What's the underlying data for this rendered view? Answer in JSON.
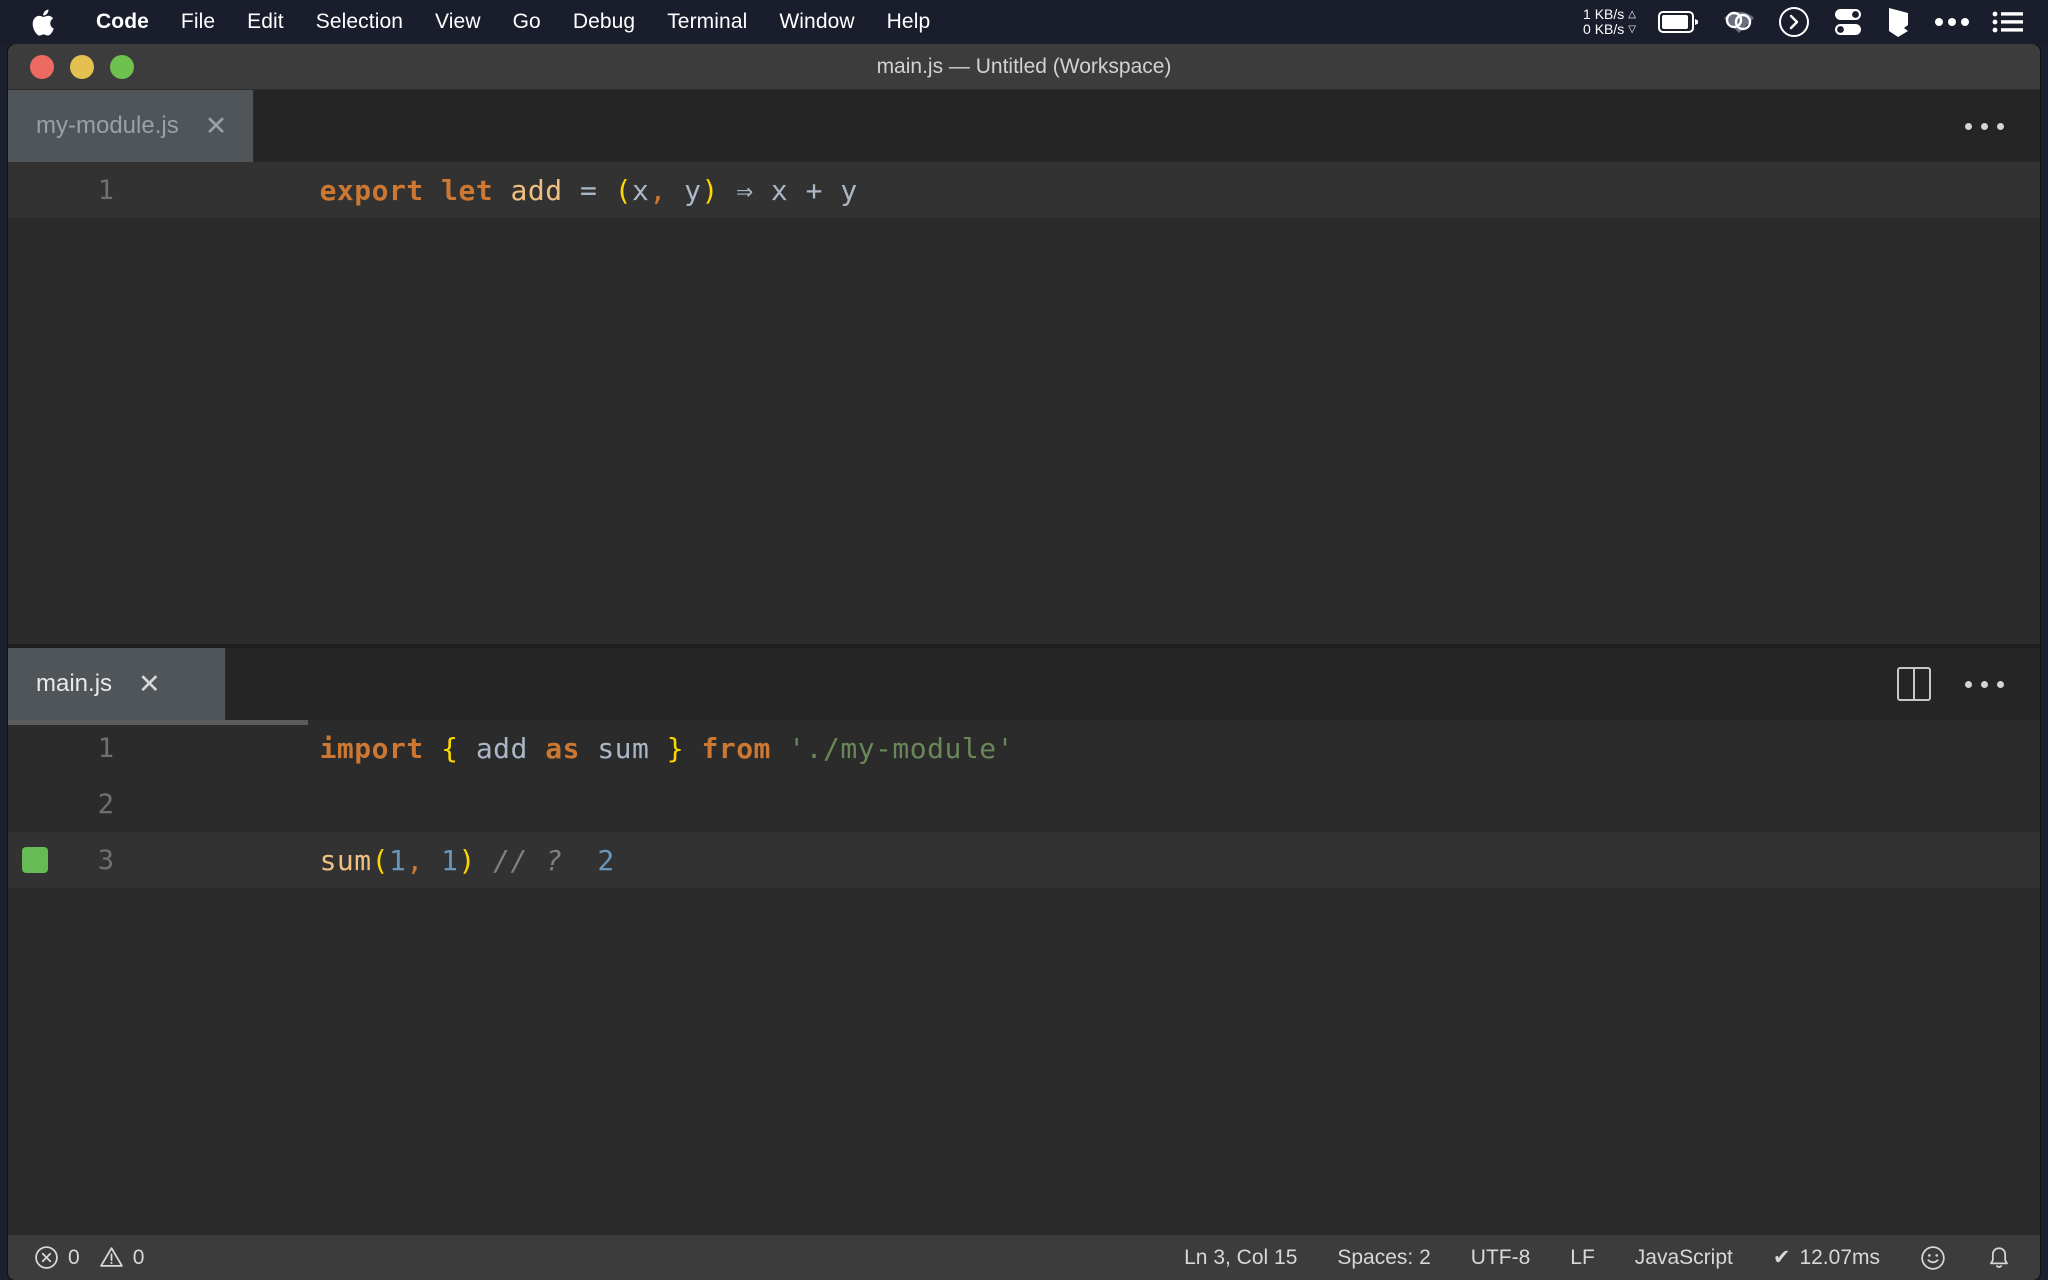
{
  "menubar": {
    "apple_icon": "apple-logo-icon",
    "items": [
      {
        "label": "Code",
        "bold": true
      },
      {
        "label": "File",
        "bold": false
      },
      {
        "label": "Edit",
        "bold": false
      },
      {
        "label": "Selection",
        "bold": false
      },
      {
        "label": "View",
        "bold": false
      },
      {
        "label": "Go",
        "bold": false
      },
      {
        "label": "Debug",
        "bold": false
      },
      {
        "label": "Terminal",
        "bold": false
      },
      {
        "label": "Window",
        "bold": false
      },
      {
        "label": "Help",
        "bold": false
      }
    ],
    "tray": {
      "net_up": "1 KB/s",
      "net_down": "0 KB/s",
      "up_arrow": "△",
      "down_arrow": "▽",
      "icons": [
        "battery-icon",
        "wifi-icon",
        "clock-chevron-icon",
        "toggles-icon",
        "bookmark-icon",
        "ellipsis-icon",
        "list-icon"
      ]
    }
  },
  "window": {
    "title": "main.js — Untitled (Workspace)",
    "traffic_lights": [
      "close-button",
      "minimize-button",
      "zoom-button"
    ]
  },
  "editor_groups": [
    {
      "tab": {
        "name": "my-module.js",
        "close": "✕",
        "active": false
      },
      "actions": {
        "split": false,
        "more": "…"
      },
      "lines": [
        {
          "number": "1",
          "current": true,
          "breakpoint": false,
          "tokens": [
            {
              "text": "export",
              "cls": "t-kw"
            },
            {
              "text": " ",
              "cls": "t-op"
            },
            {
              "text": "let",
              "cls": "t-kw"
            },
            {
              "text": " ",
              "cls": "t-op"
            },
            {
              "text": "add",
              "cls": "t-fn"
            },
            {
              "text": " = ",
              "cls": "t-op"
            },
            {
              "text": "(",
              "cls": "t-brk"
            },
            {
              "text": "x",
              "cls": "t-var"
            },
            {
              "text": ",",
              "cls": "t-comma"
            },
            {
              "text": " y",
              "cls": "t-var"
            },
            {
              "text": ")",
              "cls": "t-brk"
            },
            {
              "text": " ⇒ ",
              "cls": "t-arrow"
            },
            {
              "text": "x + y",
              "cls": "t-var"
            }
          ]
        }
      ]
    },
    {
      "tab": {
        "name": "main.js",
        "close": "✕",
        "active": true
      },
      "actions": {
        "split": true,
        "more": "…"
      },
      "lines": [
        {
          "number": "1",
          "current": false,
          "breakpoint": false,
          "tokens": [
            {
              "text": "import",
              "cls": "t-kw"
            },
            {
              "text": " ",
              "cls": "t-op"
            },
            {
              "text": "{",
              "cls": "t-brk"
            },
            {
              "text": " ",
              "cls": "t-op"
            },
            {
              "text": "add",
              "cls": "t-var"
            },
            {
              "text": " ",
              "cls": "t-op"
            },
            {
              "text": "as",
              "cls": "t-kw"
            },
            {
              "text": " ",
              "cls": "t-op"
            },
            {
              "text": "sum",
              "cls": "t-var"
            },
            {
              "text": " ",
              "cls": "t-op"
            },
            {
              "text": "}",
              "cls": "t-brk"
            },
            {
              "text": " ",
              "cls": "t-op"
            },
            {
              "text": "from",
              "cls": "t-kw"
            },
            {
              "text": " ",
              "cls": "t-op"
            },
            {
              "text": "'./my-module'",
              "cls": "t-str"
            }
          ]
        },
        {
          "number": "2",
          "current": false,
          "breakpoint": false,
          "tokens": []
        },
        {
          "number": "3",
          "current": true,
          "breakpoint": true,
          "tokens": [
            {
              "text": "sum",
              "cls": "t-fn"
            },
            {
              "text": "(",
              "cls": "t-brk"
            },
            {
              "text": "1",
              "cls": "t-num"
            },
            {
              "text": ",",
              "cls": "t-comma"
            },
            {
              "text": " ",
              "cls": "t-op"
            },
            {
              "text": "1",
              "cls": "t-num"
            },
            {
              "text": ")",
              "cls": "t-brk"
            },
            {
              "text": " ",
              "cls": "t-op"
            },
            {
              "text": "// ?",
              "cls": "t-cmt"
            },
            {
              "text": "  ",
              "cls": "t-op"
            },
            {
              "text": "2",
              "cls": "t-res"
            }
          ]
        }
      ]
    }
  ],
  "statusbar": {
    "errors": "0",
    "warnings": "0",
    "position": "Ln 3, Col 15",
    "indentation": "Spaces: 2",
    "encoding": "UTF-8",
    "eol": "LF",
    "language": "JavaScript",
    "timing": "12.07ms",
    "timing_check": "✔",
    "feedback_icon": "smiley-icon",
    "bell_icon": "bell-icon"
  },
  "colors": {
    "menubar_bg": "#191d2c",
    "titlebar_bg": "#3c3c3c",
    "editor_bg": "#2b2b2b",
    "tabbar_bg": "#252526",
    "tab_active_bg": "#50555a",
    "statusbar_bg": "#3c3c3c",
    "keyword": "#cc7832",
    "string": "#6a8759",
    "number": "#6897bb",
    "bracket": "#ffd700",
    "breakpoint": "#67bb55"
  }
}
